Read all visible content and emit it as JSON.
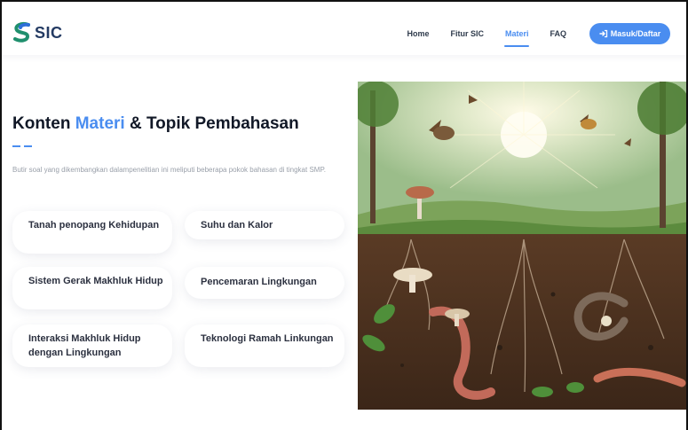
{
  "header": {
    "logo_text": "SIC",
    "nav": [
      {
        "label": "Home"
      },
      {
        "label": "Fitur SIC"
      },
      {
        "label": "Materi"
      },
      {
        "label": "FAQ"
      }
    ],
    "login_button": "Masuk/Daftar"
  },
  "hero": {
    "title_prefix": "Konten",
    "title_accent": "Materi",
    "title_suffix": "& Topik Pembahasan",
    "description": "Butir soal yang dikembangkan dalampenelitian ini meliputi beberapa pokok bahasan di tingkat SMP."
  },
  "topics": [
    {
      "label": "Tanah penopang Kehidupan"
    },
    {
      "label": "Suhu dan Kalor"
    },
    {
      "label": "Sistem Gerak Makhluk Hidup"
    },
    {
      "label": "Pencemaran Lingkungan"
    },
    {
      "label": "Interaksi Makhluk Hidup dengan Lingkungan"
    },
    {
      "label": "Teknologi Ramah Linkungan"
    }
  ],
  "colors": {
    "accent": "#4a8df0",
    "heading": "#111827",
    "muted": "#9aa0aa"
  }
}
